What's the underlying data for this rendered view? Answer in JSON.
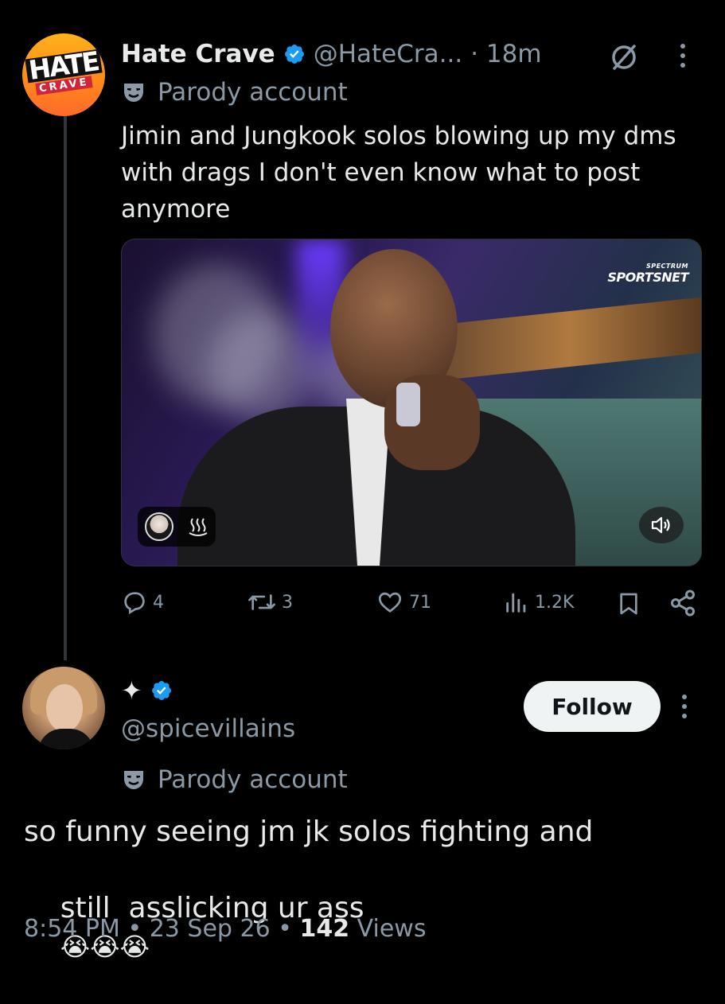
{
  "tweet": {
    "author": {
      "display_name": "Hate Crave",
      "handle": "@HateCra...",
      "time": "· 18m",
      "avatar_top_word": "HATE",
      "avatar_bottom_word": "CRAVE",
      "label": "Parody account"
    },
    "text": "Jimin and Jungkook solos blowing up my dms with drags I don't even know what to post anymore",
    "media": {
      "brand_small": "SPECTRUM",
      "brand_big": "SPORTSNET"
    },
    "actions": {
      "replies": "4",
      "reposts": "3",
      "likes": "71",
      "views": "1.2K"
    }
  },
  "reply": {
    "author": {
      "display_name": "✦",
      "handle": "@spicevillains",
      "label": "Parody account"
    },
    "follow_label": "Follow",
    "text_line1": "so funny seeing jm jk solos fighting and",
    "text_line2": "still  asslicking ur ass",
    "emoji": "😭😭😭",
    "timestamp": "8:54 PM",
    "date": "23 Sep 26",
    "views_count": "142",
    "views_label": "Views",
    "separator": "•"
  },
  "colors": {
    "background": "#000000",
    "text": "#e7e9ea",
    "muted": "#8b98a5",
    "verified": "#1d9bf0",
    "follow_button_bg": "#eff3f4"
  },
  "icons": [
    "verified-badge-icon",
    "grok-icon",
    "more-icon",
    "parody-mask-icon",
    "reply-icon",
    "repost-icon",
    "like-icon",
    "views-icon",
    "bookmark-icon",
    "share-icon",
    "sound-icon"
  ]
}
